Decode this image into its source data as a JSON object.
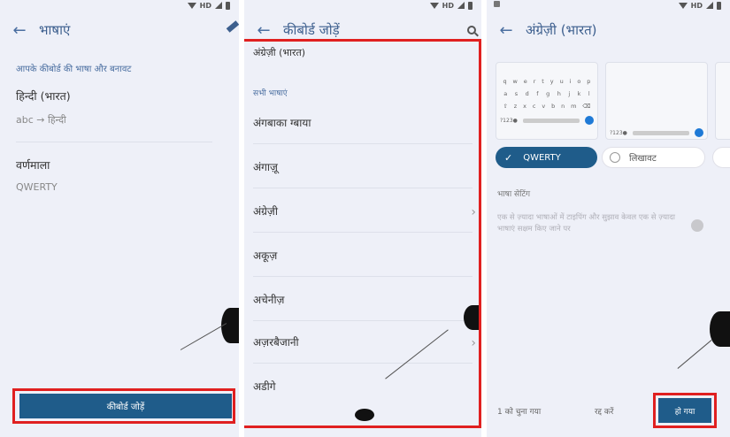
{
  "status": {
    "network": "HD"
  },
  "panel1": {
    "title": "भाषाएं",
    "section_label": "आपके कीबोर्ड की भाषा और बनावट",
    "language_name": "हिन्दी (भारत)",
    "language_sub": "abc → हिन्दी",
    "script_label": "वर्णमाला",
    "script_value": "QWERTY",
    "add_keyboard_label": "कीबोर्ड जोड़ें"
  },
  "panel2": {
    "title": "कीबोर्ड जोड़ें",
    "top_item": "अंग्रेज़ी (भारत)",
    "all_languages_label": "सभी भाषाएं",
    "languages": [
      "अंगबाका ग्बाया",
      "अंगाज़ू",
      "अंग्रेज़ी",
      "अकूज़",
      "अचेनीज़",
      "अज़रबैजानी",
      "अडीगे"
    ]
  },
  "panel3": {
    "title": "अंग्रेज़ी (भारत)",
    "keyboard_rows": [
      [
        "q",
        "w",
        "e",
        "r",
        "t",
        "y",
        "u",
        "i",
        "o",
        "p"
      ],
      [
        "a",
        "s",
        "d",
        "f",
        "g",
        "h",
        "j",
        "k",
        "l"
      ],
      [
        "z",
        "x",
        "c",
        "v",
        "b",
        "n",
        "m"
      ]
    ],
    "kbd_bottom_left": "?123",
    "layout_selected": "QWERTY",
    "layout_other": "लिखावट",
    "settings_label": "भाषा सेटिंग",
    "settings_text": "एक से ज़्यादा भाषाओं में टाइपिंग और सुझाव केवल एक से ज़्यादा भाषाएं सक्षम किए जाने पर",
    "selected_count": "1 को चुना गया",
    "cancel_label": "रद्द करें",
    "done_label": "हो गया"
  },
  "colors": {
    "accent": "#1f5c8a",
    "highlight_box": "#e02020",
    "background": "#eef0f8"
  }
}
